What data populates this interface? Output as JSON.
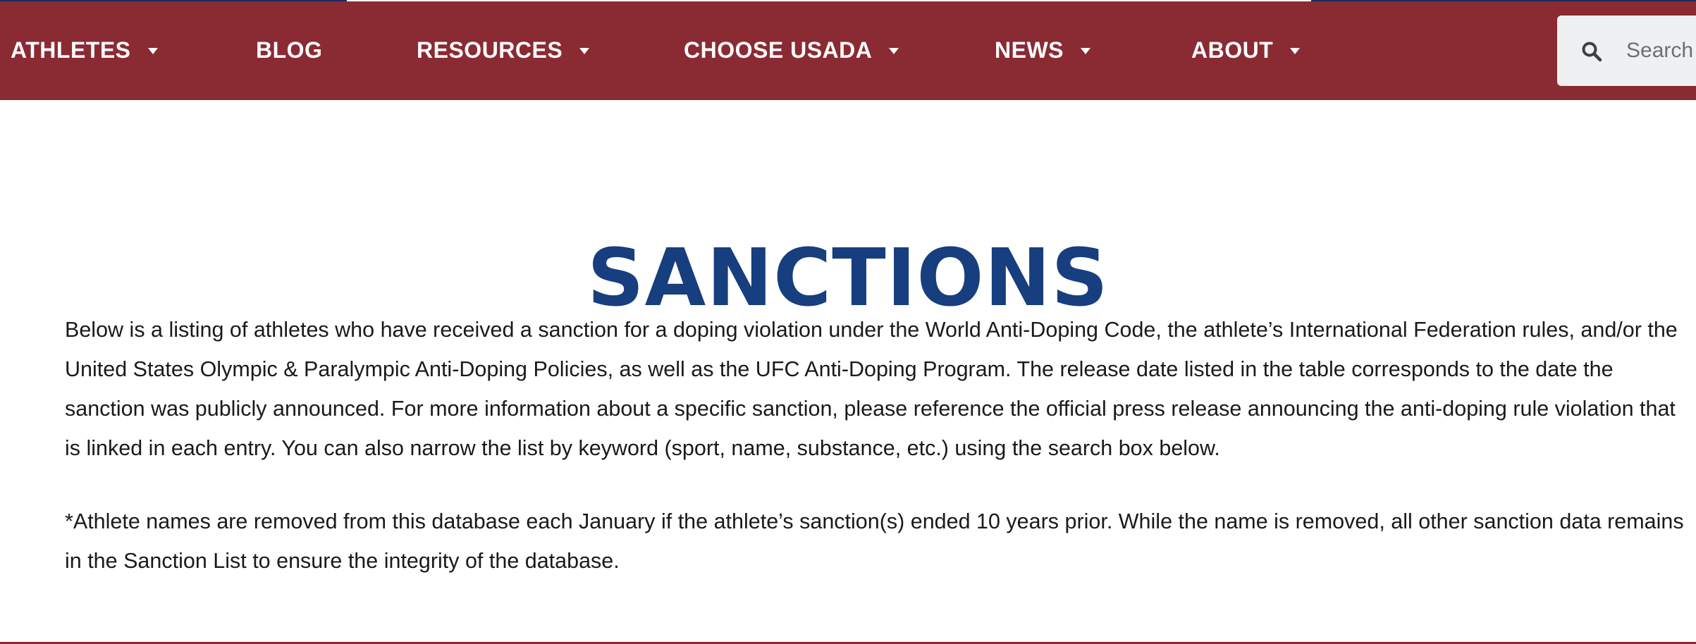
{
  "nav": {
    "items": [
      {
        "label": "ATHLETES",
        "has_dropdown": true
      },
      {
        "label": "BLOG",
        "has_dropdown": false
      },
      {
        "label": "RESOURCES",
        "has_dropdown": true
      },
      {
        "label": "CHOOSE USADA",
        "has_dropdown": true
      },
      {
        "label": "NEWS",
        "has_dropdown": true
      },
      {
        "label": "ABOUT",
        "has_dropdown": true
      }
    ],
    "search_placeholder": "Search",
    "search_icon": "search-icon",
    "dropdown_icon": "caret-down-icon"
  },
  "colors": {
    "nav_background": "#8a2a33",
    "title": "#173e7e",
    "body_text": "#1a1a1a",
    "search_background": "#eef0f2"
  },
  "main": {
    "title": "SANCTIONS",
    "intro": "Below is a listing of athletes who have received a sanction for a doping violation under the World Anti-Doping Code, the athlete’s International Federation rules, and/or the United States Olympic & Paralympic Anti-Doping Policies, as well as the UFC Anti-Doping Program. The release date listed in the table corresponds to the date the sanction was publicly announced. For more information about a specific sanction, please reference the official press release announcing the anti-doping rule violation that is linked in each entry. You can also narrow the list by keyword (sport, name, substance, etc.) using the search box below.",
    "note": "*Athlete names are removed from this database each January if the athlete’s sanction(s) ended 10 years prior. While the name is removed, all other sanction data remains in the Sanction List to ensure the integrity of the database."
  }
}
